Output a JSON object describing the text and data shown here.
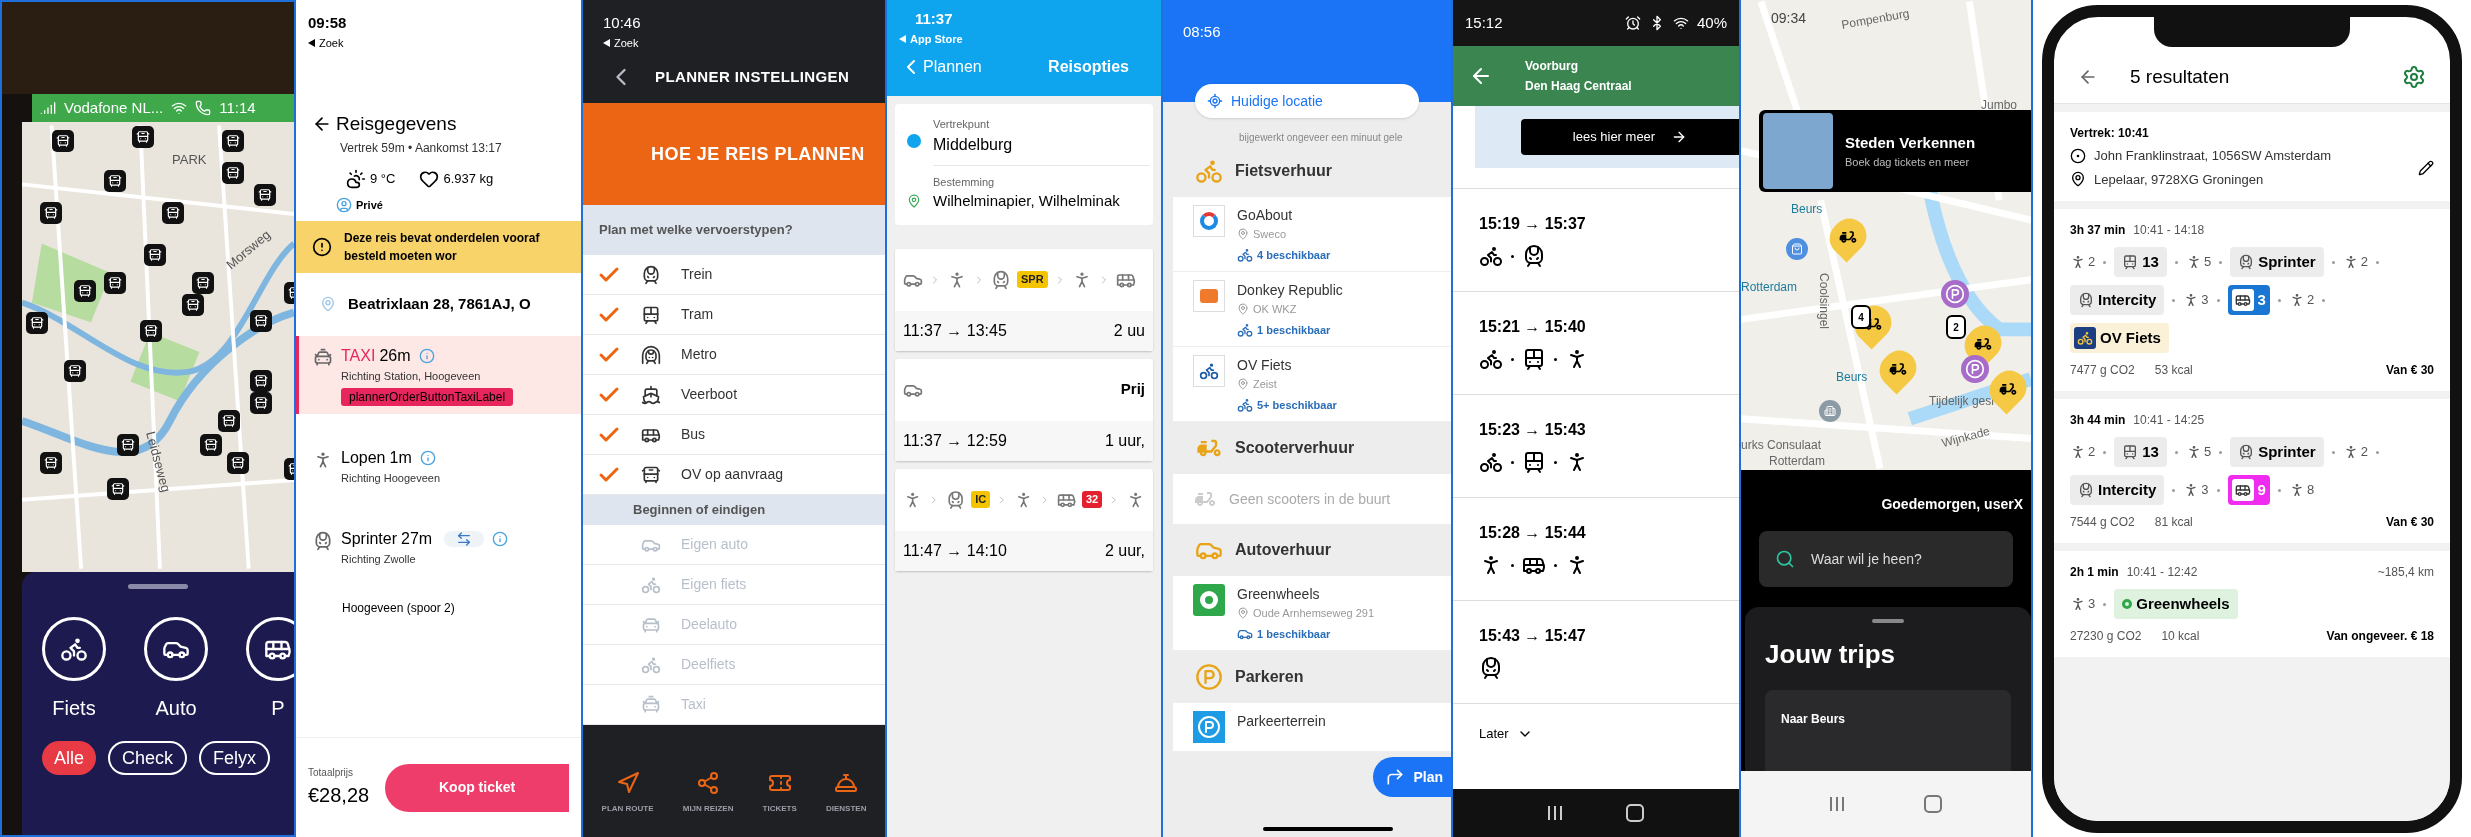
{
  "scooter_map": {
    "status": {
      "carrier": "Vodafone NL...",
      "time": "11:14"
    },
    "map_labels": [
      "PARK",
      "Morsweg",
      "Leidseweg"
    ],
    "modes": [
      {
        "label": "Fiets",
        "kind": "bike"
      },
      {
        "label": "Auto",
        "kind": "car"
      },
      {
        "label": "P",
        "kind": "bus"
      }
    ],
    "filters": [
      {
        "label": "Alle",
        "selected": true
      },
      {
        "label": "Check",
        "selected": false
      },
      {
        "label": "Felyx",
        "selected": false
      }
    ]
  },
  "trip_details": {
    "status": {
      "time": "09:58",
      "back": "Zoek"
    },
    "title": "Reisgegevens",
    "subtitle": "Vertrek 59m • Aankomst 13:17",
    "temperature": "9 °C",
    "co2": "6.937 kg",
    "profile": "Privé",
    "alert": "Deze reis bevat onderdelen vooraf besteld moeten wor",
    "origin": "Beatrixlaan 28, 7861AJ, O",
    "legs": [
      {
        "kind": "taxi",
        "mode": "TAXI",
        "duration": "26m",
        "direction": "Richting Station, Hoogeveen",
        "action": "plannerOrderButtonTaxiLabel",
        "highlighted": true
      },
      {
        "kind": "walk",
        "mode": "Lopen",
        "duration": "1m",
        "direction": "Richting Hoogeveen",
        "highlighted": false
      },
      {
        "kind": "train",
        "mode": "Sprinter",
        "duration": "27m",
        "direction": "Richting Zwolle",
        "highlighted": false
      }
    ],
    "stop": "Hoogeveen (spoor 2)",
    "total_label": "Totaalprijs",
    "total": "€28,28",
    "buy_button": "Koop ticket"
  },
  "planner_settings": {
    "status": {
      "time": "10:46",
      "back": "Zoek"
    },
    "title": "PLANNER INSTELLINGEN",
    "banner": "HOE JE REIS PLANNEN",
    "groups": [
      {
        "title": "Plan met welke vervoerstypen?",
        "modes": [
          {
            "label": "Trein",
            "kind": "train",
            "checked": true
          },
          {
            "label": "Tram",
            "kind": "tram",
            "checked": true
          },
          {
            "label": "Metro",
            "kind": "metro",
            "checked": true
          },
          {
            "label": "Veerboot",
            "kind": "ferry",
            "checked": true
          },
          {
            "label": "Bus",
            "kind": "bus",
            "checked": true
          },
          {
            "label": "OV op aanvraag",
            "kind": "ondemand",
            "checked": true
          }
        ]
      },
      {
        "title": "Beginnen of eindigen",
        "modes": [
          {
            "label": "Eigen auto",
            "kind": "car",
            "checked": false
          },
          {
            "label": "Eigen fiets",
            "kind": "bike",
            "checked": false
          },
          {
            "label": "Deelauto",
            "kind": "sharecar",
            "checked": false
          },
          {
            "label": "Deelfiets",
            "kind": "sharebike",
            "checked": false
          },
          {
            "label": "Taxi",
            "kind": "taxi",
            "checked": false
          }
        ]
      }
    ],
    "nav": [
      {
        "label": "PLAN ROUTE",
        "kind": "route"
      },
      {
        "label": "MIJN REIZEN",
        "kind": "trips"
      },
      {
        "label": "TICKETS",
        "kind": "tickets"
      },
      {
        "label": "DIENSTEN",
        "kind": "services"
      }
    ]
  },
  "travel_options": {
    "status": {
      "time": "11:37",
      "back": "App Store"
    },
    "back": "Plannen",
    "title": "Reisopties",
    "origin_label": "Vertrekpunt",
    "origin": "Middelburg",
    "destination_label": "Bestemming",
    "destination": "Wilhelminapier, Wilhelminak",
    "options": [
      {
        "legs": [
          {
            "kind": "car"
          },
          {
            "kind": "walk"
          },
          {
            "kind": "train",
            "badge": "SPR",
            "color": "#f5c400"
          },
          {
            "kind": "walk"
          },
          {
            "kind": "bus"
          }
        ],
        "times": "11:37 → 13:45",
        "duration": "2 uu"
      },
      {
        "legs": [
          {
            "kind": "car"
          }
        ],
        "note": "Prij",
        "times": "11:37 → 12:59",
        "duration": "1 uur,"
      },
      {
        "legs": [
          {
            "kind": "walk"
          },
          {
            "kind": "train",
            "badge": "IC",
            "color": "#f5c400"
          },
          {
            "kind": "walk"
          },
          {
            "kind": "bus",
            "badge": "32",
            "color": "#e5202e"
          },
          {
            "kind": "walk"
          }
        ],
        "times": "11:47 → 14:10",
        "duration": "2 uur,"
      }
    ]
  },
  "nearby_rentals": {
    "status": {
      "time": "08:56"
    },
    "location": "Huidige locatie",
    "updated": "bijgewerkt ongeveer een minuut gele",
    "sections": [
      {
        "title": "Fietsverhuur",
        "kind": "bike",
        "providers": [
          {
            "name": "GoAbout",
            "kind": "goabout",
            "location": "Sweco",
            "available": "4 beschikbaar"
          },
          {
            "name": "Donkey Republic",
            "kind": "donkey",
            "location": "OK WKZ",
            "available": "1 beschikbaar"
          },
          {
            "name": "OV Fiets",
            "kind": "ovfiets",
            "location": "Zeist",
            "available": "5+ beschikbaar"
          }
        ]
      },
      {
        "title": "Scooterverhuur",
        "kind": "scooter",
        "empty": "Geen scooters in de buurt"
      },
      {
        "title": "Autoverhuur",
        "kind": "car",
        "providers": [
          {
            "name": "Greenwheels",
            "kind": "greenwheels",
            "location": "Oude Arnhemseweg 291",
            "available": "1 beschikbaar"
          }
        ]
      },
      {
        "title": "Parkeren",
        "kind": "parking",
        "providers": [
          {
            "name": "Parkeerterrein",
            "kind": "parking"
          }
        ]
      }
    ],
    "plan_button": "Plan"
  },
  "trip_list": {
    "status": {
      "time": "15:12",
      "battery": "40%"
    },
    "from": "Voorburg",
    "to": "Den Haag Centraal",
    "info_button": "lees hier meer",
    "trips": [
      {
        "times": "15:19 → 15:37",
        "legs": [
          {
            "kind": "bike"
          },
          {
            "kind": "train"
          }
        ]
      },
      {
        "times": "15:21 → 15:40",
        "legs": [
          {
            "kind": "bike"
          },
          {
            "kind": "tram"
          },
          {
            "kind": "walk"
          }
        ]
      },
      {
        "times": "15:23 → 15:43",
        "legs": [
          {
            "kind": "bike"
          },
          {
            "kind": "tram"
          },
          {
            "kind": "walk"
          }
        ]
      },
      {
        "times": "15:28 → 15:44",
        "legs": [
          {
            "kind": "walk"
          },
          {
            "kind": "bus"
          },
          {
            "kind": "walk"
          }
        ]
      },
      {
        "times": "15:43 → 15:47",
        "legs": [
          {
            "kind": "train"
          }
        ]
      }
    ],
    "later": "Later"
  },
  "city_map": {
    "status": {
      "time": "09:34"
    },
    "map_labels": [
      "Pompenburg",
      "Jumbo",
      "Beurs",
      "Rotterdam",
      "Coolsingel",
      "Beurs",
      "Tijdelijk gesl",
      "Wijnkade",
      "urks Consulaat",
      "Rotterdam"
    ],
    "clusters": [
      "4",
      "2"
    ],
    "promo": {
      "title": "Steden Verkennen",
      "subtitle": "Boek dag tickets en meer"
    },
    "greeting": "Goedemorgen, userX",
    "search": {
      "placeholder": "Waar wil je heen?"
    },
    "trips_title": "Jouw trips",
    "trip": "Naar Beurs"
  },
  "results": {
    "title": "5 resultaten",
    "departure": "Vertrek: 10:41",
    "from": "John Franklinstraat, 1056SW Amsterdam",
    "to": "Lepelaar, 9728XG Groningen",
    "items": [
      {
        "duration": "3h 37 min",
        "times": "10:41 - 14:18",
        "legs": [
          {
            "kind": "walk",
            "label": "2"
          },
          {
            "kind": "tram",
            "label": "13"
          },
          {
            "kind": "walk",
            "label": "5"
          },
          {
            "kind": "train",
            "label": "Sprinter"
          },
          {
            "kind": "walk",
            "label": "2"
          },
          {
            "kind": "train",
            "label": "Intercity"
          },
          {
            "kind": "walk",
            "label": "3"
          },
          {
            "kind": "bus",
            "label": "3",
            "color": "#1976d2"
          },
          {
            "kind": "walk",
            "label": "2"
          },
          {
            "kind": "ovfiets",
            "label": "OV Fiets"
          }
        ],
        "co2": "7477 g CO2",
        "kcal": "53 kcal",
        "price": "Van € 30"
      },
      {
        "duration": "3h 44 min",
        "times": "10:41 - 14:25",
        "legs": [
          {
            "kind": "walk",
            "label": "2"
          },
          {
            "kind": "tram",
            "label": "13"
          },
          {
            "kind": "walk",
            "label": "5"
          },
          {
            "kind": "train",
            "label": "Sprinter"
          },
          {
            "kind": "walk",
            "label": "2"
          },
          {
            "kind": "train",
            "label": "Intercity"
          },
          {
            "kind": "walk",
            "label": "3"
          },
          {
            "kind": "bus",
            "label": "9",
            "color": "#f02cf0"
          },
          {
            "kind": "walk",
            "label": "8"
          }
        ],
        "co2": "7544 g CO2",
        "kcal": "81 kcal",
        "price": "Van € 30"
      },
      {
        "duration": "2h 1 min",
        "times": "10:41 - 12:42",
        "distance": "~185,4 km",
        "legs": [
          {
            "kind": "walk",
            "label": "3"
          },
          {
            "kind": "greenwheels",
            "label": "Greenwheels"
          }
        ],
        "co2": "27230 g CO2",
        "kcal": "10 kcal",
        "price": "Van ongeveer. € 18"
      }
    ]
  }
}
